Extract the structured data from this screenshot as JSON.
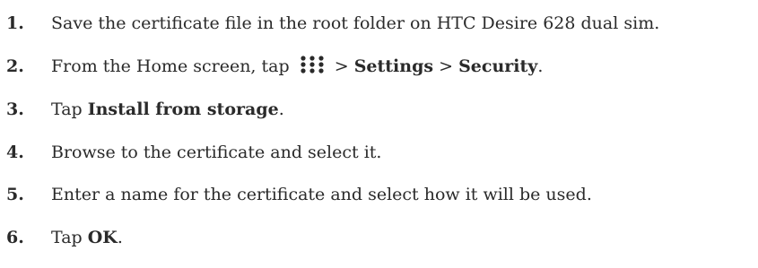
{
  "steps": [
    {
      "number": "1.",
      "text": "Save the certificate file in the root folder on HTC Desire 628 dual sim."
    },
    {
      "number": "2.",
      "text_before_icon": "From the Home screen, tap",
      "icon": "apps-grid-icon",
      "sep1": " > ",
      "settings": "Settings",
      "sep2": " > ",
      "security": "Security",
      "end": "."
    },
    {
      "number": "3.",
      "prefix": "Tap ",
      "action": "Install from storage",
      "end": "."
    },
    {
      "number": "4.",
      "text": "Browse to the certificate and select it."
    },
    {
      "number": "5.",
      "text": "Enter a name for the certificate and select how it will be used."
    },
    {
      "number": "6.",
      "prefix": "Tap ",
      "action": "OK",
      "end": "."
    }
  ]
}
